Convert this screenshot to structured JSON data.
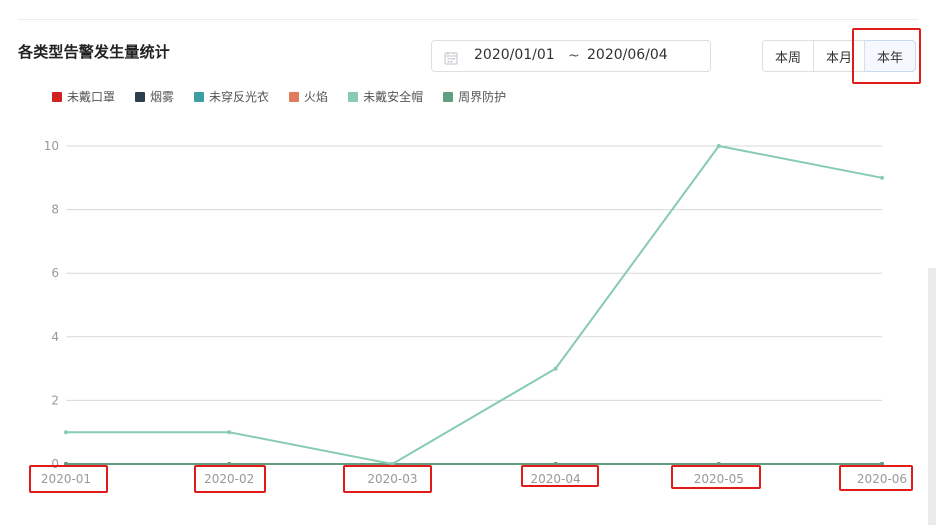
{
  "title": "各类型告警发生量统计",
  "date_range": {
    "start": "2020/01/01",
    "separator": "~",
    "end": "2020/06/04"
  },
  "range_buttons": [
    "本周",
    "本月",
    "本年"
  ],
  "colors": {
    "grid": "#d9d9d9",
    "axis_label": "#999999",
    "highlight": "#e31a1a"
  },
  "chart_data": {
    "type": "line",
    "categories": [
      "2020-01",
      "2020-02",
      "2020-03",
      "2020-04",
      "2020-05",
      "2020-06"
    ],
    "ylim": [
      0,
      10
    ],
    "yticks": [
      0,
      2,
      4,
      6,
      8,
      10
    ],
    "grid": true,
    "legend_position": "top-left",
    "series": [
      {
        "name": "未戴口罩",
        "color": "#d0231f",
        "values": [
          0,
          0,
          0,
          0,
          0,
          0
        ]
      },
      {
        "name": "烟雾",
        "color": "#2b3f4c",
        "values": [
          0,
          0,
          0,
          0,
          0,
          0
        ]
      },
      {
        "name": "未穿反光衣",
        "color": "#3a9ea3",
        "values": [
          0,
          0,
          0,
          0,
          0,
          0
        ]
      },
      {
        "name": "火焰",
        "color": "#e07b5c",
        "values": [
          0,
          0,
          0,
          0,
          0,
          0
        ]
      },
      {
        "name": "未戴安全帽",
        "color": "#86cbb2",
        "values": [
          1,
          1,
          0,
          3,
          10,
          9
        ]
      },
      {
        "name": "周界防护",
        "color": "#5f9e7f",
        "values": [
          0,
          0,
          0,
          0,
          0,
          0
        ]
      }
    ]
  }
}
